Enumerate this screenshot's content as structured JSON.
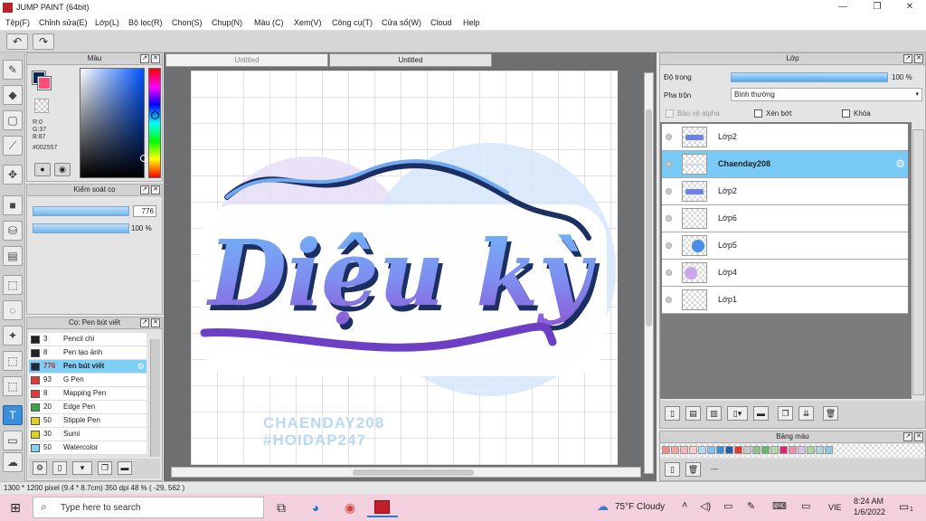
{
  "window": {
    "title": "JUMP PAINT (64bit)",
    "minimize": "—",
    "maximize": "❐",
    "close": "✕"
  },
  "menu": [
    "Tệp(F)",
    "Chỉnh sửa(E)",
    "Lớp(L)",
    "Bộ lọc(R)",
    "Chọn(S)",
    "Chụp(N)",
    "Màu (C)",
    "Xem(V)",
    "Công cụ(T)",
    "Cửa sổ(W)",
    "Cloud",
    "Help"
  ],
  "toolbar": {
    "undo": "↶",
    "redo": "↷"
  },
  "color_panel": {
    "title": "Màu",
    "r": "R:0",
    "g": "G:37",
    "b": "B:87",
    "hex": "#002557",
    "fg_color": "#002557",
    "bg_color": "#ff4c78"
  },
  "brush_control": {
    "title": "Kiểm soát cọ",
    "size_value": "776",
    "opacity_value": "100 %",
    "size_level": 1.0,
    "opacity_level": 1.0
  },
  "brush_list": {
    "title": "Cọ: Pen bút viết",
    "items": [
      {
        "size": "3",
        "name": "Pencil chì",
        "color": "#222222"
      },
      {
        "size": "8",
        "name": "Pen tạo ảnh",
        "color": "#222222"
      },
      {
        "size": "776",
        "name": "Pen bút viết",
        "color": "#1c2a48"
      },
      {
        "size": "93",
        "name": "G Pen",
        "color": "#e53935"
      },
      {
        "size": "8",
        "name": "Mapping Pen",
        "color": "#e53935"
      },
      {
        "size": "20",
        "name": "Edge Pen",
        "color": "#3aa640"
      },
      {
        "size": "50",
        "name": "Stipple Pen",
        "color": "#e0d020"
      },
      {
        "size": "30",
        "name": "Sumi",
        "color": "#e0d020"
      },
      {
        "size": "50",
        "name": "Watercolor",
        "color": "#7fd6f2"
      }
    ]
  },
  "tabs": [
    "Untitled",
    "Untitled"
  ],
  "canvas": {
    "main_text": "Diệu kỳ",
    "watermark1": "CHAENDAY208",
    "watermark2": "#HOIDAP247"
  },
  "layer_panel": {
    "title": "Lớp",
    "opacity_label": "Độ trong",
    "opacity_value": "100 %",
    "blend_label": "Pha trộn",
    "blend_value": "Bình thường",
    "protect_alpha": "Bảo vệ alpha",
    "clipping": "Xén bớt",
    "lock": "Khóa",
    "layers": [
      {
        "name": "Lớp2"
      },
      {
        "name": "Chaenday208"
      },
      {
        "name": "Lớp2"
      },
      {
        "name": "Lớp6"
      },
      {
        "name": "Lớp5"
      },
      {
        "name": "Lớp4"
      },
      {
        "name": "Lớp1"
      }
    ]
  },
  "palette_panel": {
    "title": "Bảng màu",
    "dash": "---",
    "colors": [
      "#f08c8c",
      "#f2a3a3",
      "#f5b7b7",
      "#f9c8c8",
      "#b0d8f5",
      "#7cc3ef",
      "#3b8fd8",
      "#1f5fa8",
      "#e53935",
      "#c8c8c8",
      "#8fc38a",
      "#6bb36a",
      "#b6d7a8",
      "#e02070",
      "#ee8fb0",
      "#d7c3e6",
      "#a8d49f",
      "#a8d4e0",
      "#8cc8e0"
    ]
  },
  "status": "1300 * 1200 pixel  (9.4 * 8.7cm)  350 dpi  48 %  ( -29, 562 )",
  "taskbar": {
    "search_placeholder": "Type here to search",
    "weather": "75°F  Cloudy",
    "lang": "VIE",
    "time": "8:24 AM",
    "date": "1/6/2022",
    "notif": "1"
  }
}
